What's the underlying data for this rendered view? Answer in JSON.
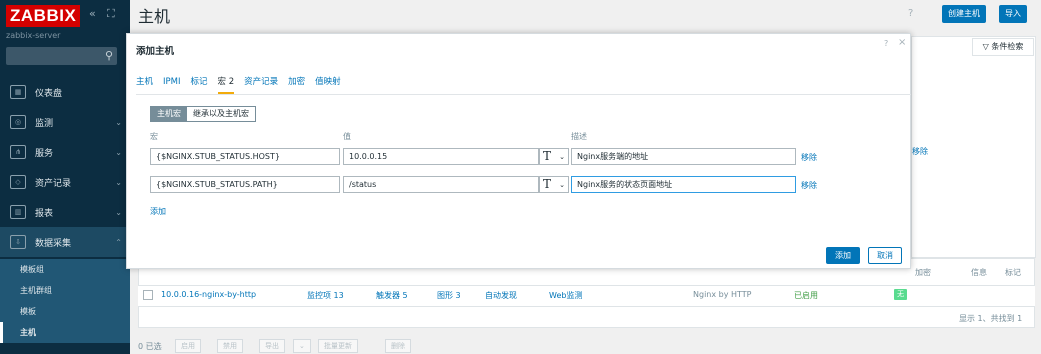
{
  "sidebar": {
    "logo": "ZABBIX",
    "server": "zabbix-server",
    "items": [
      {
        "label": "仪表盘",
        "icon": "dashboard-icon"
      },
      {
        "label": "监测",
        "icon": "monitoring-icon"
      },
      {
        "label": "服务",
        "icon": "services-icon"
      },
      {
        "label": "资产记录",
        "icon": "inventory-icon"
      },
      {
        "label": "报表",
        "icon": "reports-icon"
      },
      {
        "label": "数据采集",
        "icon": "data-collection-icon"
      }
    ],
    "submenu": [
      "模板组",
      "主机群组",
      "模板",
      "主机"
    ]
  },
  "header": {
    "title": "主机",
    "help": "?",
    "create_host": "创建主机",
    "import": "导入"
  },
  "background": {
    "filter_tab": "条件检索",
    "remove_partial": "移除",
    "col_encryption": "加密",
    "col_info": "信息",
    "col_tags": "标记",
    "row": {
      "name": "10.0.0.16-nginx-by-http",
      "items": "监控项 13",
      "triggers": "触发器 5",
      "graphs": "图形 3",
      "discovery": "自动发现",
      "web": "Web监测",
      "template": "Nginx by HTTP",
      "status": "已启用",
      "encryption": "无"
    },
    "summary": "显示 1、共找到 1",
    "bottom": {
      "selected": "0 已选",
      "enable": "启用",
      "disable": "禁用",
      "export": "导出",
      "mass_update": "批量更新",
      "delete": "删除"
    }
  },
  "modal": {
    "title": "添加主机",
    "help": "?",
    "tabs": [
      "主机",
      "IPMI",
      "标记",
      "宏 2",
      "资产记录",
      "加密",
      "值映射"
    ],
    "active_tab": 3,
    "toggle": {
      "host_macros": "主机宏",
      "inherited": "继承以及主机宏"
    },
    "columns": {
      "macro": "宏",
      "value": "值",
      "description": "描述"
    },
    "rows": [
      {
        "macro": "{$NGINX.STUB_STATUS.HOST}",
        "value": "10.0.0.15",
        "type": "T",
        "description": "Nginx服务端的地址",
        "remove": "移除"
      },
      {
        "macro": "{$NGINX.STUB_STATUS.PATH}",
        "value": "/status",
        "type": "T",
        "description": "Nginx服务的状态页面地址",
        "remove": "移除"
      }
    ],
    "add_link": "添加",
    "add_button": "添加",
    "cancel_button": "取消"
  }
}
